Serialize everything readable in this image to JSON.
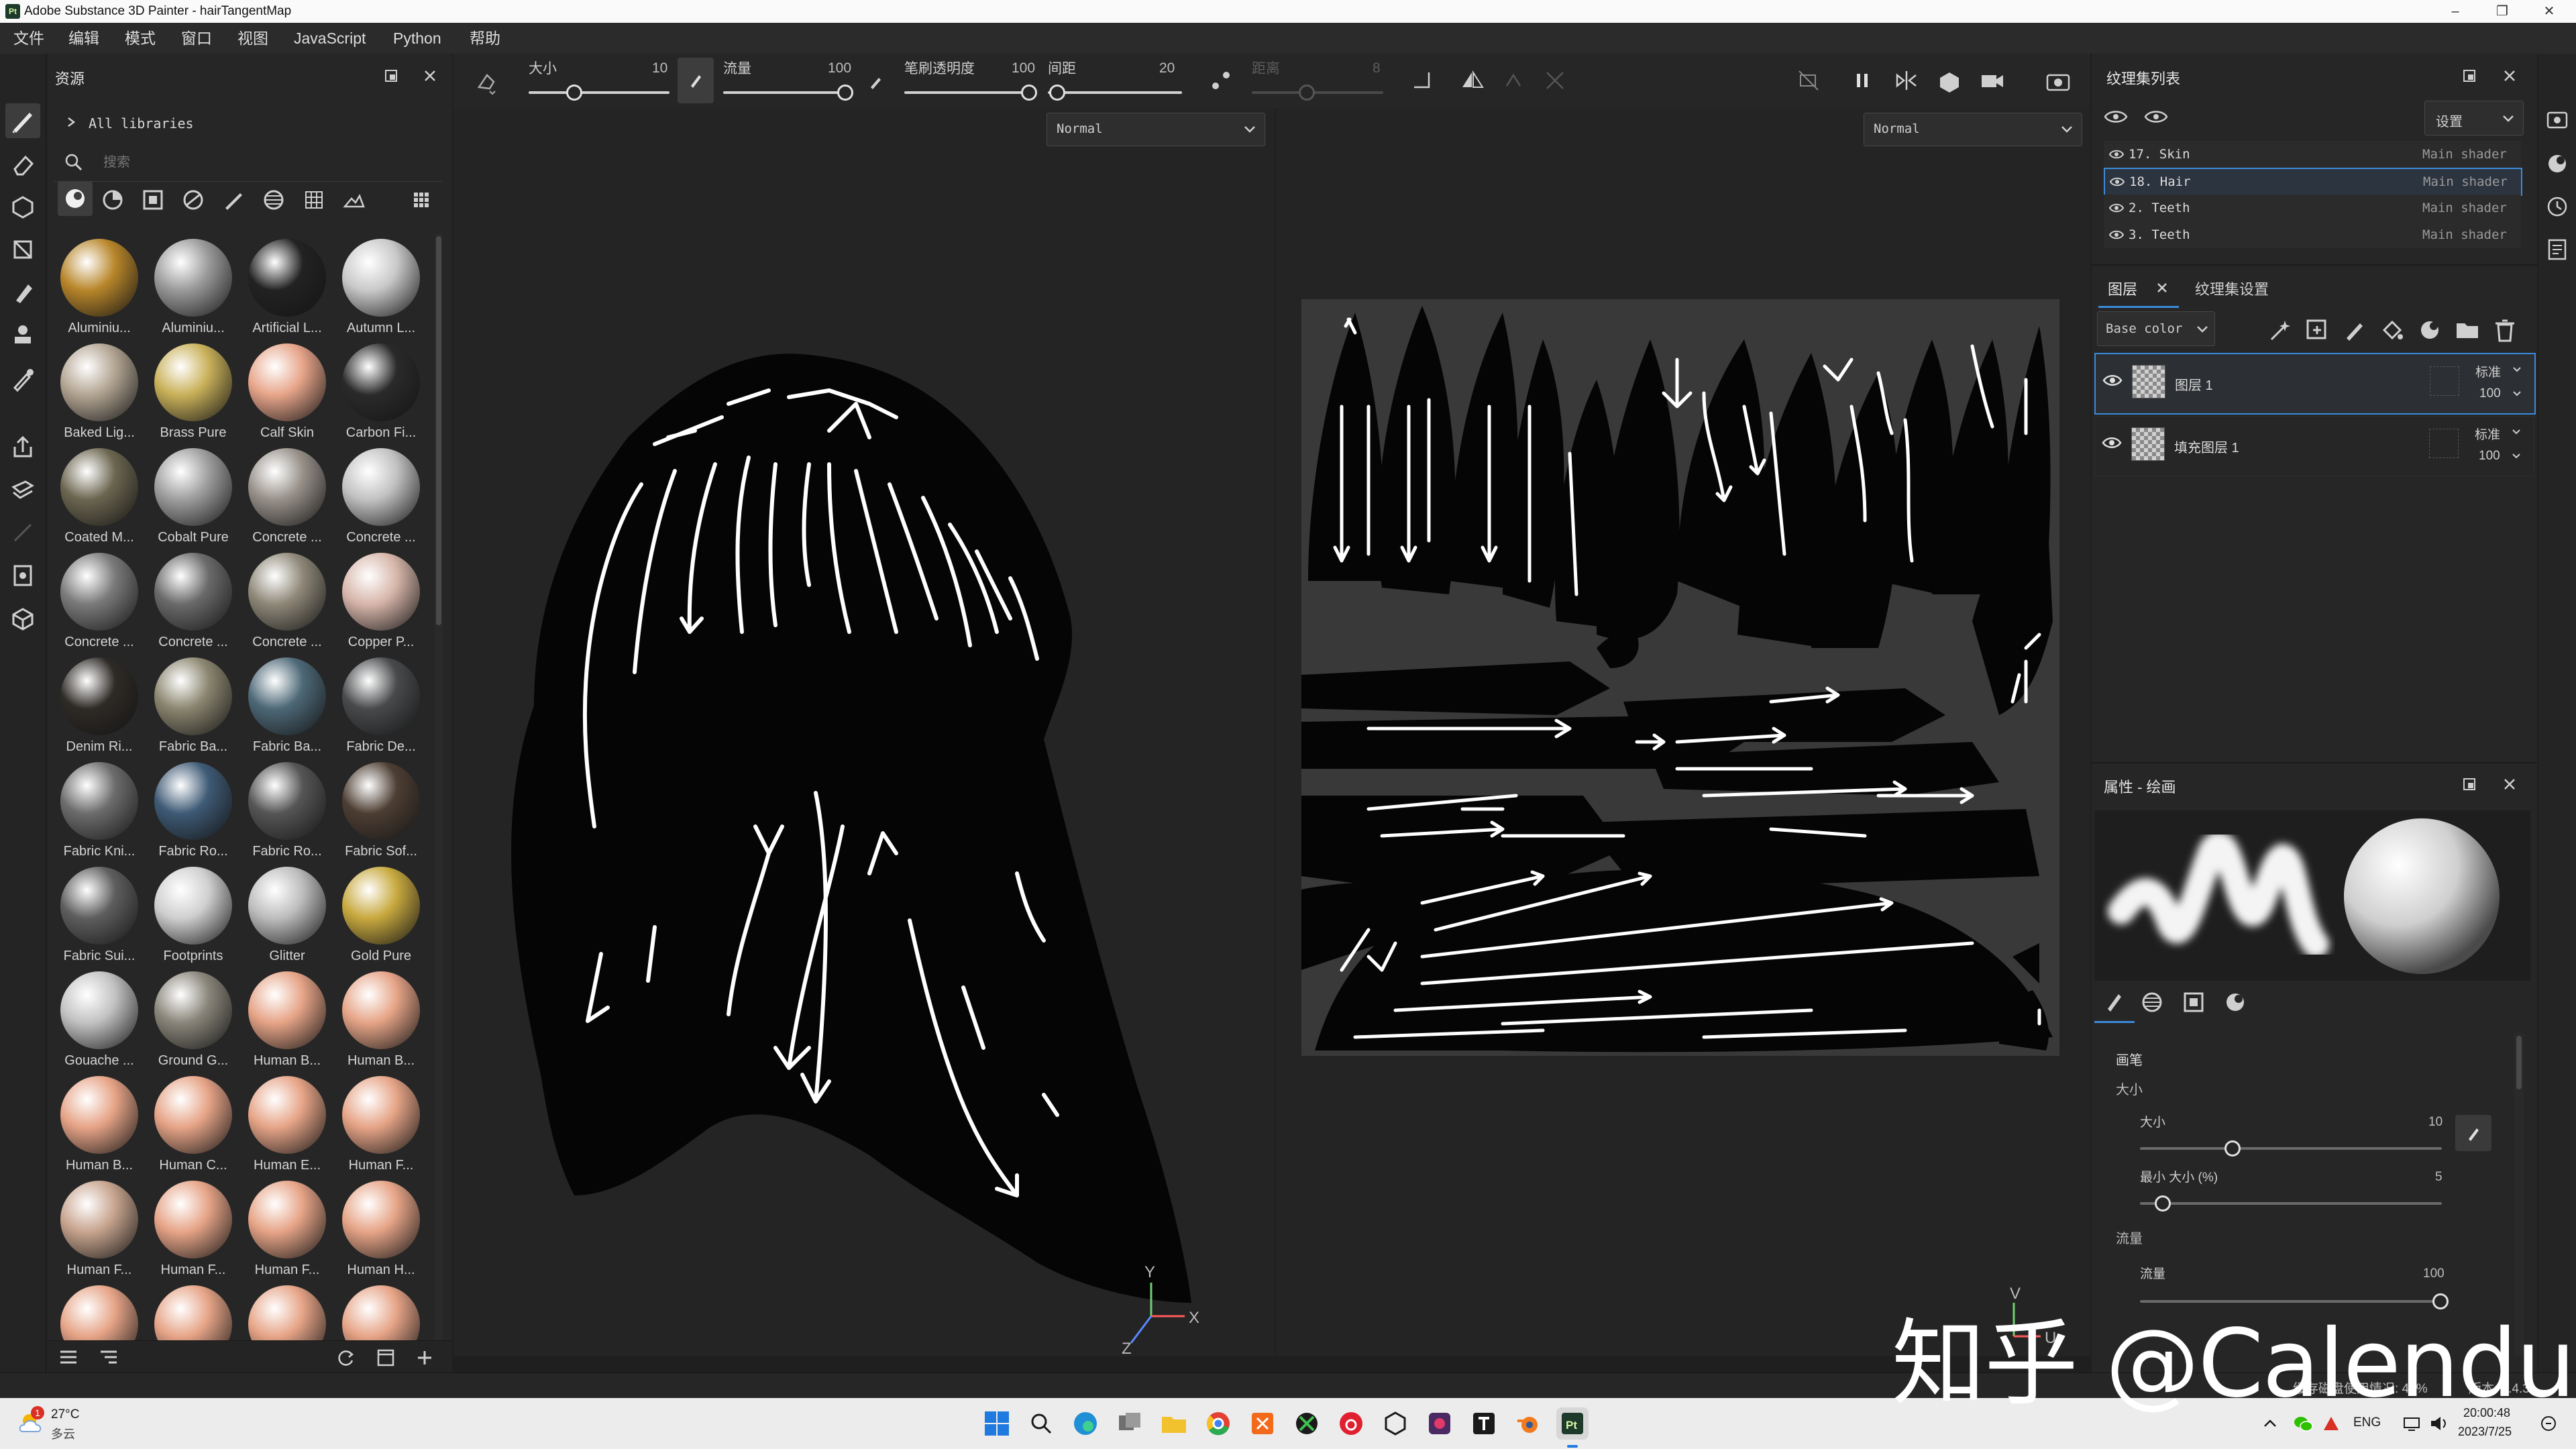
{
  "app": {
    "title": "Adobe Substance 3D Painter - hairTangentMap",
    "logo_text": "Pt"
  },
  "window_controls": {
    "minimize": "–",
    "maximize": "❐",
    "close": "✕"
  },
  "menu": [
    "文件",
    "编辑",
    "模式",
    "窗口",
    "视图",
    "JavaScript",
    "Python",
    "帮助"
  ],
  "assets": {
    "title": "资源",
    "breadcrumb": "All libraries",
    "search_placeholder": "搜索",
    "materials": [
      {
        "label": "Aluminiu...",
        "color": "#b8862a"
      },
      {
        "label": "Aluminiu...",
        "color": "#9a9a9a"
      },
      {
        "label": "Artificial L...",
        "color": "#222222"
      },
      {
        "label": "Autumn L...",
        "color": "#c9c9c9"
      },
      {
        "label": "Baked Lig...",
        "color": "#b3a593"
      },
      {
        "label": "Brass Pure",
        "color": "#c9b15a"
      },
      {
        "label": "Calf Skin",
        "color": "#e7a58a"
      },
      {
        "label": "Carbon Fi...",
        "color": "#2a2a2a"
      },
      {
        "label": "Coated M...",
        "color": "#6c6650"
      },
      {
        "label": "Cobalt Pure",
        "color": "#9e9e9e"
      },
      {
        "label": "Concrete ...",
        "color": "#98918a"
      },
      {
        "label": "Concrete ...",
        "color": "#c2c2c2"
      },
      {
        "label": "Concrete ...",
        "color": "#7a7a7a"
      },
      {
        "label": "Concrete ...",
        "color": "#6a6a6a"
      },
      {
        "label": "Concrete ...",
        "color": "#8f8879"
      },
      {
        "label": "Copper P...",
        "color": "#d7b6aa"
      },
      {
        "label": "Denim Ri...",
        "color": "#2e2a26"
      },
      {
        "label": "Fabric Ba...",
        "color": "#8b8670"
      },
      {
        "label": "Fabric Ba...",
        "color": "#4d6877"
      },
      {
        "label": "Fabric De...",
        "color": "#484a4c"
      },
      {
        "label": "Fabric Kni...",
        "color": "#6c6c6c"
      },
      {
        "label": "Fabric Ro...",
        "color": "#3e5a75"
      },
      {
        "label": "Fabric Ro...",
        "color": "#555555"
      },
      {
        "label": "Fabric Sof...",
        "color": "#4d3e33"
      },
      {
        "label": "Fabric Sui...",
        "color": "#5e5e5e"
      },
      {
        "label": "Footprints",
        "color": "#cfcfcf"
      },
      {
        "label": "Glitter",
        "color": "#bdbdbd"
      },
      {
        "label": "Gold Pure",
        "color": "#c8a93f"
      },
      {
        "label": "Gouache ...",
        "color": "#c2c2c2"
      },
      {
        "label": "Ground G...",
        "color": "#89857a"
      },
      {
        "label": "Human B...",
        "color": "#e6a487"
      },
      {
        "label": "Human B...",
        "color": "#e6a487"
      },
      {
        "label": "Human B...",
        "color": "#e6a487"
      },
      {
        "label": "Human C...",
        "color": "#e6a487"
      },
      {
        "label": "Human E...",
        "color": "#e6a487"
      },
      {
        "label": "Human F...",
        "color": "#e6a487"
      },
      {
        "label": "Human F...",
        "color": "#c7a48e"
      },
      {
        "label": "Human F...",
        "color": "#e6a487"
      },
      {
        "label": "Human F...",
        "color": "#e6a487"
      },
      {
        "label": "Human H...",
        "color": "#e6a487"
      },
      {
        "label": "",
        "color": "#e6a487"
      },
      {
        "label": "",
        "color": "#e6a487"
      },
      {
        "label": "",
        "color": "#e6a487"
      },
      {
        "label": "",
        "color": "#e6a487"
      }
    ]
  },
  "toolbar": {
    "size_label": "大小",
    "size_value": "10",
    "flow_label": "流量",
    "flow_value": "100",
    "opacity_label": "笔刷透明度",
    "opacity_value": "100",
    "spacing_label": "间距",
    "spacing_value": "20",
    "distance_label": "距离",
    "distance_value": "8"
  },
  "viewports": {
    "blend_3d": "Normal",
    "blend_2d": "Normal",
    "axis_y": "Y",
    "axis_x": "X",
    "axis_z": "Z",
    "axis2d_v": "V",
    "axis2d_u": "U"
  },
  "texture_sets": {
    "title": "纹理集列表",
    "settings_label": "设置",
    "rows": [
      {
        "name": "17. Skin",
        "shader": "Main shader",
        "selected": false
      },
      {
        "name": "18. Hair",
        "shader": "Main shader",
        "selected": true
      },
      {
        "name": "2. Teeth",
        "shader": "Main shader",
        "selected": false
      },
      {
        "name": "3. Teeth",
        "shader": "Main shader",
        "selected": false
      }
    ]
  },
  "layers": {
    "tab_layers": "图层",
    "tab_settings": "纹理集设置",
    "channel": "Base color",
    "items": [
      {
        "name": "图层 1",
        "blend": "标准",
        "opacity": "100",
        "selected": true
      },
      {
        "name": "填充图层 1",
        "blend": "标准",
        "opacity": "100",
        "selected": false
      }
    ]
  },
  "properties": {
    "title": "属性 - 绘画",
    "section_brush": "画笔",
    "group_size": "大小",
    "size_label": "大小",
    "size_value": "10",
    "min_size_label": "最小 大小 (%)",
    "min_size_value": "5",
    "group_flow": "流量",
    "flow_label": "流量",
    "flow_value": "100"
  },
  "status": {
    "cache": "缓存磁盘使用情况: 46%",
    "version": "版本: 7.4.3"
  },
  "taskbar": {
    "weather_temp": "27°C",
    "weather_desc": "多云",
    "weather_badge": "1",
    "lang": "ENG",
    "time": "20:00:48",
    "date": "2023/7/25"
  },
  "watermark": "知乎 @Calendula",
  "colors": {
    "accent_blue": "#3b8ad9",
    "panel": "#262626",
    "hair_black": "#050505",
    "strokes": "#ffffff"
  }
}
